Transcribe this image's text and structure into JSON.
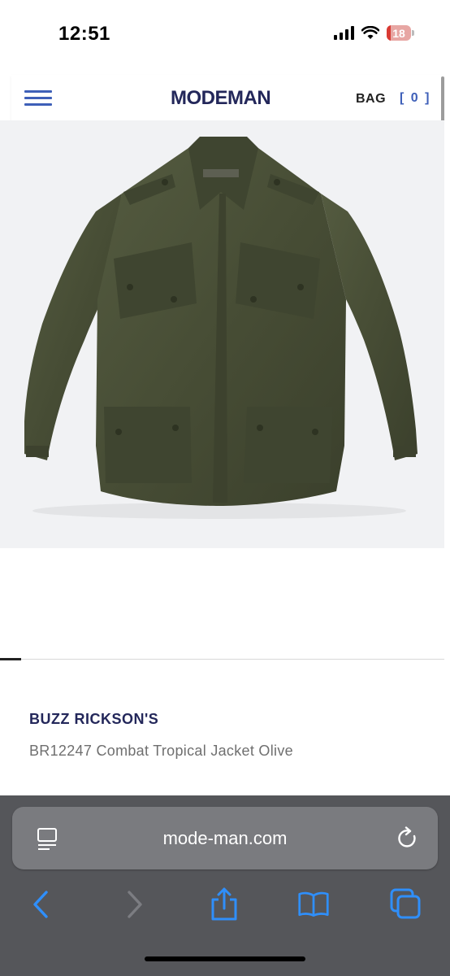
{
  "status_bar": {
    "time": "12:51",
    "battery": "18",
    "battery_level": 0.18
  },
  "header": {
    "logo": "MODEMAN",
    "bag_label": "BAG",
    "bag_count": "[ 0 ]"
  },
  "product": {
    "image_alt": "Olive combat tropical jacket",
    "brand": "BUZZ RICKSON'S",
    "name": "BR12247 Combat Tropical Jacket Olive"
  },
  "browser": {
    "url": "mode-man.com"
  },
  "colors": {
    "brand_navy": "#23275a",
    "accent_blue": "#3e5fb8",
    "jacket_olive": "#4a5038",
    "browser_gray": "#55565a"
  }
}
